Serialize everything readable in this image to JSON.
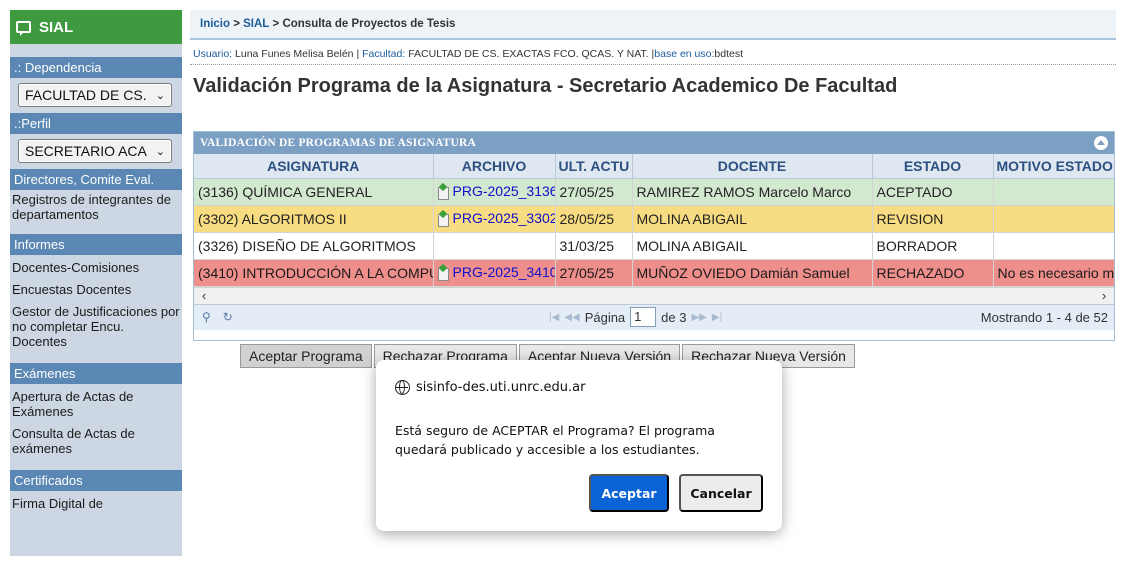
{
  "sidebar": {
    "brand": "SIAL",
    "sections": [
      {
        "title": ".: Dependencia",
        "select": "FACULTAD DE CS."
      },
      {
        "title": ".:Perfil",
        "select": "SECRETARIO ACA"
      }
    ],
    "groups": [
      {
        "title": "Directores, Comite Eval.",
        "links": [
          "Registros de integrantes de departamentos"
        ]
      },
      {
        "title": "Informes",
        "links": [
          "Docentes-Comisiones",
          "Encuestas Docentes",
          "Gestor de Justificaciones por no completar Encu. Docentes"
        ]
      },
      {
        "title": "Exámenes",
        "links": [
          "Apertura de Actas de Exámenes",
          "Consulta de Actas de exámenes"
        ]
      },
      {
        "title": "Certificados",
        "links": [
          "Firma Digital de"
        ]
      }
    ]
  },
  "breadcrumb": {
    "home": "Inicio",
    "sep1": " > ",
    "app": "SIAL",
    "sep2": " > ",
    "current": "Consulta de Proyectos de Tesis"
  },
  "userline": {
    "user_label": "Usuario:",
    "user": "Luna Funes Melisa Belén",
    "sep1": " | ",
    "faculty_label": "Facultad:",
    "faculty": "FACULTAD DE CS. EXACTAS FCO. QCAS. Y NAT.",
    "sep2": " |",
    "db_label": "base en uso:",
    "db": "bdtest"
  },
  "page_title": "Validación Programa de la Asignatura - Secretario Academico De Facultad",
  "grid": {
    "caption": "VALIDACIÓN DE PROGRAMAS DE ASIGNATURA",
    "columns": [
      "ASIGNATURA",
      "ARCHIVO",
      "ULT. ACTU",
      "DOCENTE",
      "ESTADO",
      "MOTIVO ESTADO"
    ],
    "rows": [
      {
        "asignatura": "(3136) QUÍMICA GENERAL",
        "archivo": "PRG-2025_3136",
        "ult": "27/05/25",
        "docente": "RAMIREZ RAMOS Marcelo Marco",
        "estado": "ACEPTADO",
        "motivo": "",
        "color": "#d2e8cf"
      },
      {
        "asignatura": "(3302) ALGORITMOS II",
        "archivo": "PRG-2025_3302",
        "ult": "28/05/25",
        "docente": "MOLINA ABIGAIL",
        "estado": "REVISION",
        "motivo": "",
        "color": "#f8dc82"
      },
      {
        "asignatura": "(3326) DISEÑO DE ALGORITMOS",
        "archivo": "",
        "ult": "31/03/25",
        "docente": "MOLINA ABIGAIL",
        "estado": "BORRADOR",
        "motivo": "",
        "color": "#ffffff"
      },
      {
        "asignatura": "(3410) INTRODUCCIÓN A LA COMPU",
        "archivo": "PRG-2025_3410",
        "ult": "27/05/25",
        "docente": "MUÑOZ OVIEDO Damián Samuel",
        "estado": "RECHAZADO",
        "motivo": "No es necesario m",
        "color": "#ef8f8c"
      }
    ],
    "pager": {
      "page_label": "Página",
      "page": "1",
      "of_label": "de 3",
      "showing": "Mostrando 1 - 4 de 52"
    }
  },
  "actions": {
    "accept_program": "Aceptar Programa",
    "reject_program": "Rechazar Programa",
    "accept_new_version": "Aceptar Nueva Versión",
    "reject_new_version": "Rechazar Nueva Versión"
  },
  "dialog": {
    "origin": "sisinfo-des.uti.unrc.edu.ar",
    "message": "Está seguro de ACEPTAR el Programa? El programa quedará publicado y accesible a los estudiantes.",
    "ok": "Aceptar",
    "cancel": "Cancelar"
  }
}
